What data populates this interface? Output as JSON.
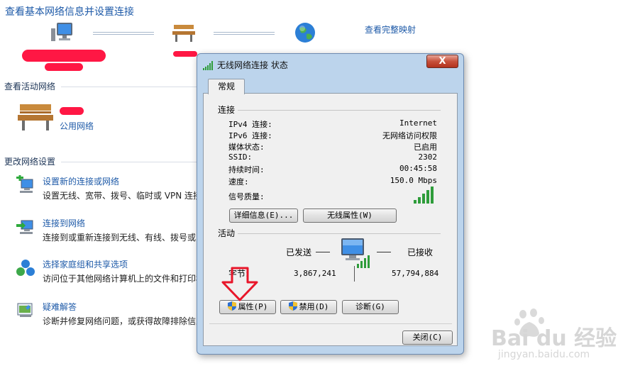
{
  "page": {
    "title": "查看基本网络信息并设置连接",
    "map_link": "查看完整映射",
    "active_networks_heading": "查看活动网络",
    "network_type_link": "公用网络",
    "change_settings_heading": "更改网络设置",
    "tasks": [
      {
        "link": "设置新的连接或网络",
        "desc": "设置无线、宽带、拨号、临时或 VPN 连接",
        "icon": "new-connection-icon"
      },
      {
        "link": "连接到网络",
        "desc": "连接到或重新连接到无线、有线、拨号或 VPN",
        "icon": "connect-network-icon"
      },
      {
        "link": "选择家庭组和共享选项",
        "desc": "访问位于其他网络计算机上的文件和打印机",
        "icon": "homegroup-icon"
      },
      {
        "link": "疑难解答",
        "desc": "诊断并修复网络问题，或获得故障排除信息",
        "icon": "troubleshoot-icon"
      }
    ]
  },
  "dialog": {
    "title": "无线网络连接 状态",
    "close_label": "X",
    "tab_label": "常规",
    "connection_group": "连接",
    "rows": [
      {
        "label": "IPv4 连接:",
        "value": "Internet"
      },
      {
        "label": "IPv6 连接:",
        "value": "无网络访问权限"
      },
      {
        "label": "媒体状态:",
        "value": "已启用"
      },
      {
        "label": "SSID:",
        "value": "2302"
      },
      {
        "label": "持续时间:",
        "value": "00:45:58"
      },
      {
        "label": "速度:",
        "value": "150.0 Mbps"
      }
    ],
    "signal_label": "信号质量:",
    "signal_bars": 5,
    "details_button": "详细信息(E)...",
    "wireless_props_button": "无线属性(W)",
    "activity_group": "活动",
    "sent_label": "已发送",
    "received_label": "已接收",
    "bytes_label": "字节:",
    "bytes_sent": "3,867,241",
    "bytes_received": "57,794,884",
    "properties_button": "属性(P)",
    "disable_button": "禁用(D)",
    "diagnose_button": "诊断(G)",
    "close_button": "关闭(C)"
  },
  "watermark": {
    "brand": "Bai du 经验",
    "url": "jingyan.baidu.com"
  },
  "colors": {
    "link_blue": "#1e5aa8",
    "dialog_frame": "#bcd4ec",
    "annotation_red": "#e8162a"
  }
}
